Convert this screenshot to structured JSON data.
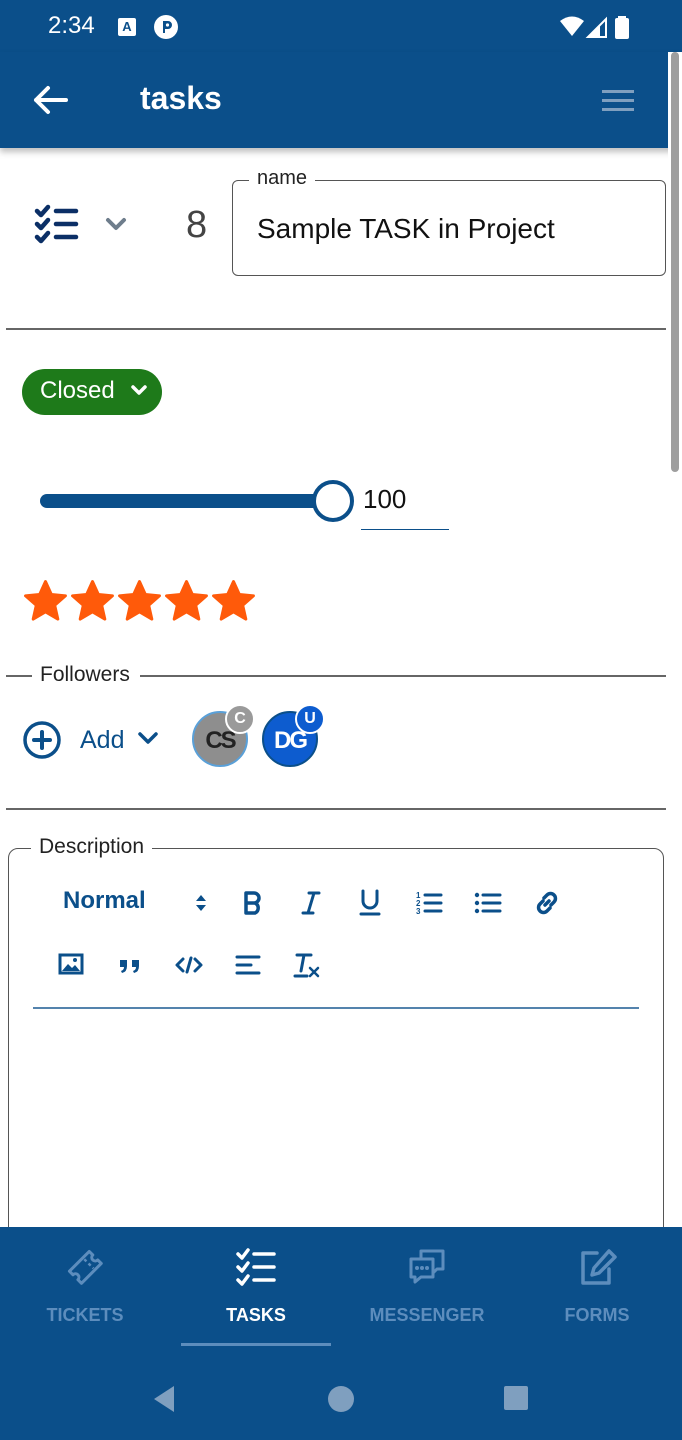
{
  "status_bar": {
    "time": "2:34",
    "icons": [
      "a-notification-icon",
      "p-notification-icon",
      "wifi-icon",
      "signal-icon",
      "battery-icon"
    ]
  },
  "app_bar": {
    "title": "tasks",
    "back_icon": "arrow-left-icon",
    "menu_icon": "hamburger-menu-icon"
  },
  "task": {
    "type_icon": "task-list-icon",
    "number": "8",
    "name_label": "name",
    "name_value": "Sample TASK in Project",
    "status": "Closed",
    "progress": 100,
    "progress_label": "100",
    "rating": 5,
    "rating_max": 5
  },
  "followers": {
    "label": "Followers",
    "add_label": "Add",
    "avatars": [
      {
        "initials": "CS",
        "badge": "C"
      },
      {
        "initials": "DG",
        "badge": "U"
      }
    ]
  },
  "description": {
    "label": "Description",
    "format_value": "Normal",
    "toolbar": [
      "bold-icon",
      "italic-icon",
      "underline-icon",
      "ordered-list-icon",
      "bullet-list-icon",
      "link-icon",
      "image-icon",
      "blockquote-icon",
      "code-icon",
      "align-icon",
      "clear-format-icon"
    ],
    "content": ""
  },
  "bottom_nav": {
    "items": [
      {
        "label": "TICKETS",
        "icon": "ticket-icon",
        "active": false
      },
      {
        "label": "TASKS",
        "icon": "tasks-icon",
        "active": true
      },
      {
        "label": "MESSENGER",
        "icon": "messenger-icon",
        "active": false
      },
      {
        "label": "FORMS",
        "icon": "form-edit-icon",
        "active": false
      }
    ]
  },
  "colors": {
    "primary": "#0b4f8a",
    "status_closed": "#1e7a1a",
    "star": "#ff5a0a",
    "nav_inactive": "#5d8dbd"
  }
}
